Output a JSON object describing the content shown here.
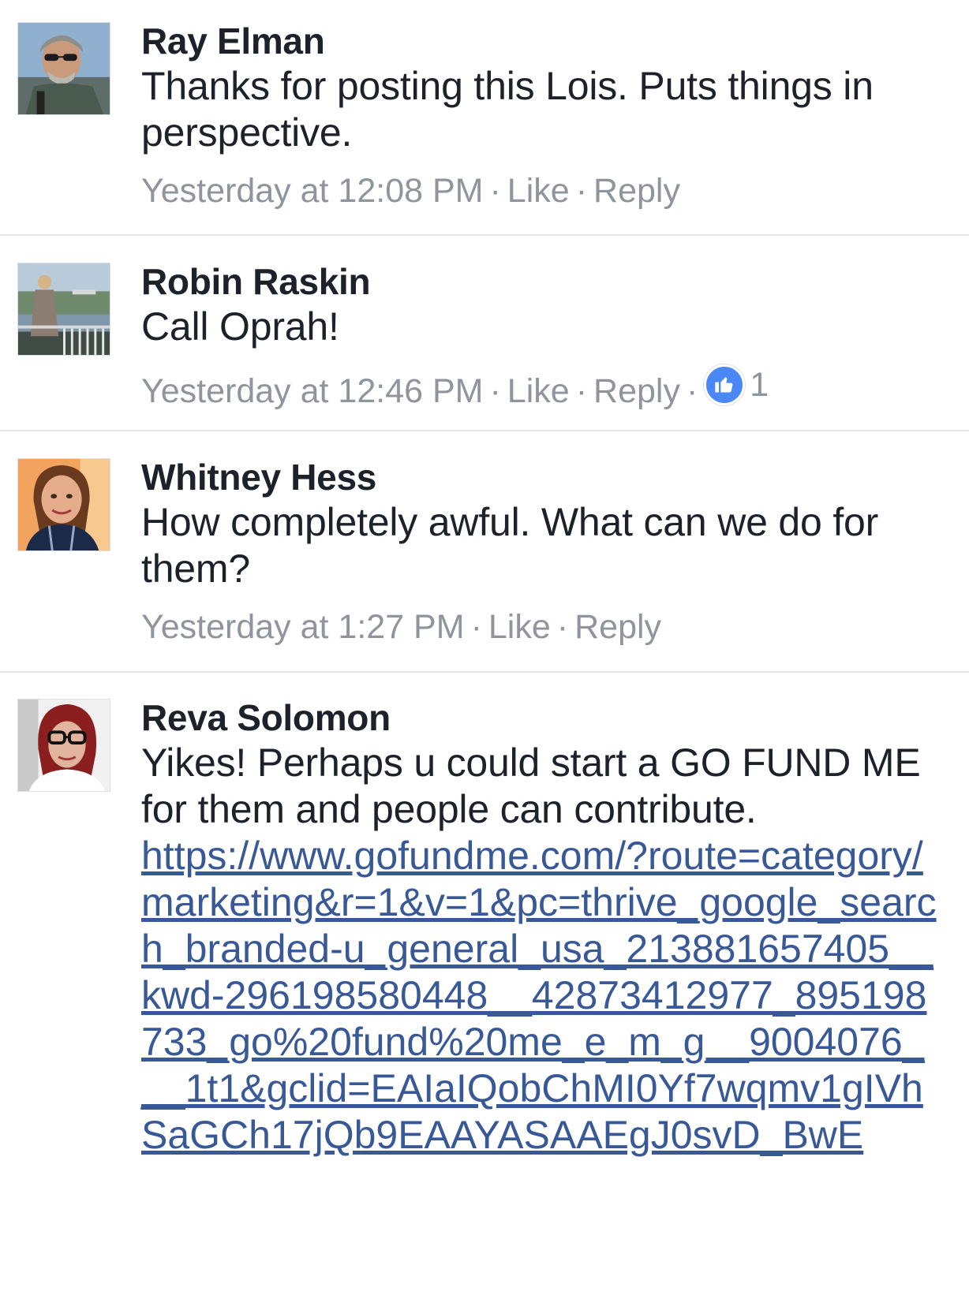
{
  "comments": [
    {
      "author": "Ray Elman",
      "text": "Thanks for posting this Lois. Puts things in perspective.",
      "timestamp": "Yesterday at 12:08 PM",
      "like_label": "Like",
      "reply_label": "Reply",
      "avatar_icon": "profile-photo-ray-elman"
    },
    {
      "author": "Robin Raskin",
      "text": "Call Oprah!",
      "timestamp": "Yesterday at 12:46 PM",
      "like_label": "Like",
      "reply_label": "Reply",
      "reaction_count": "1",
      "reaction_icon": "like-reaction-icon",
      "avatar_icon": "profile-photo-robin-raskin"
    },
    {
      "author": "Whitney Hess",
      "text": "How completely awful. What can we do for them?",
      "timestamp": "Yesterday at 1:27 PM",
      "like_label": "Like",
      "reply_label": "Reply",
      "avatar_icon": "profile-photo-whitney-hess"
    },
    {
      "author": "Reva Solomon",
      "text": "Yikes! Perhaps u could start a GO FUND ME for them and people can contribute.",
      "link": "https://www.gofundme.com/?route=category/marketing&r=1&v=1&pc=thrive_google_search_branded-u_general_usa_213881657405__kwd-296198580448__42873412977_895198733_go%20fund%20me_e_m_g__9004076___1t1&gclid=EAIaIQobChMI0Yf7wqmv1gIVhSaGCh17jQb9EAAYASAAEgJ0svD_BwE",
      "avatar_icon": "profile-photo-reva-solomon"
    }
  ],
  "separator": "·",
  "colors": {
    "author": "#1d2129",
    "meta": "#90949c",
    "link": "#385898",
    "like_badge": "#4b88f7",
    "divider": "#e5e6e9"
  }
}
